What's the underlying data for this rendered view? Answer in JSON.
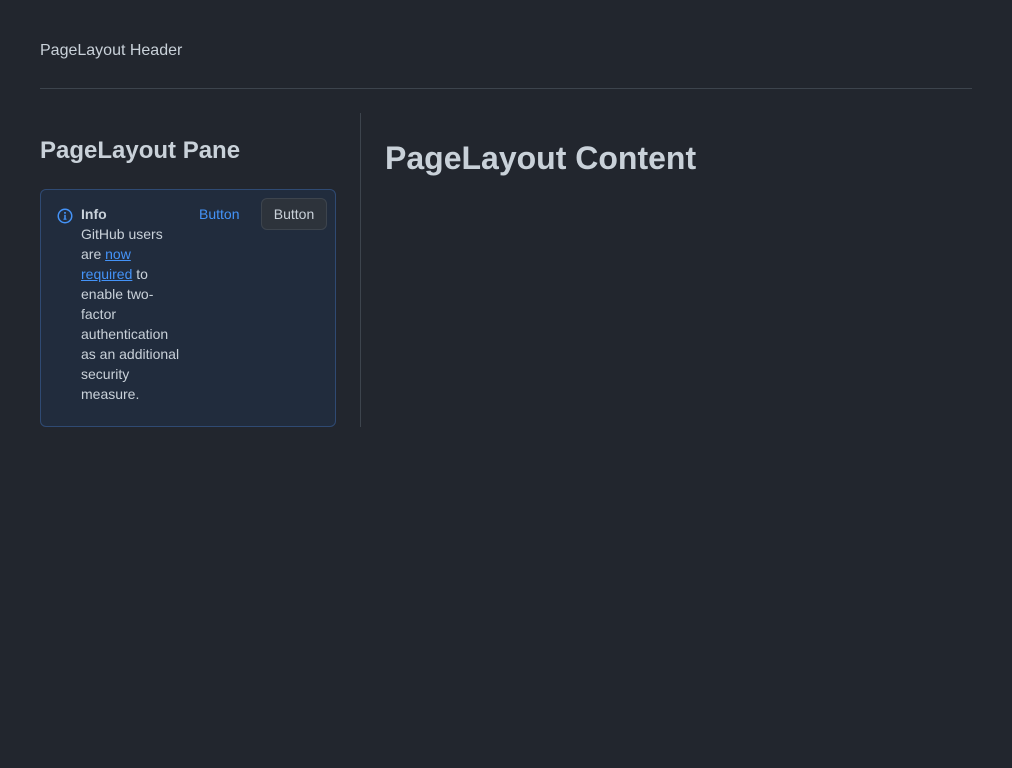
{
  "header": {
    "label": "PageLayout Header"
  },
  "pane": {
    "title": "PageLayout Pane",
    "banner": {
      "icon": "info-icon",
      "title": "Info",
      "text_before": "GitHub users are ",
      "link_text": "now required",
      "text_after": " to enable two-factor authentication as an additional security measure.",
      "link_button_label": "Button",
      "secondary_button_label": "Button"
    }
  },
  "content": {
    "title": "PageLayout Content"
  },
  "colors": {
    "background": "#22262e",
    "accent": "#4493f8",
    "banner_bg": "#212c3d",
    "banner_border": "#2f4a73"
  }
}
